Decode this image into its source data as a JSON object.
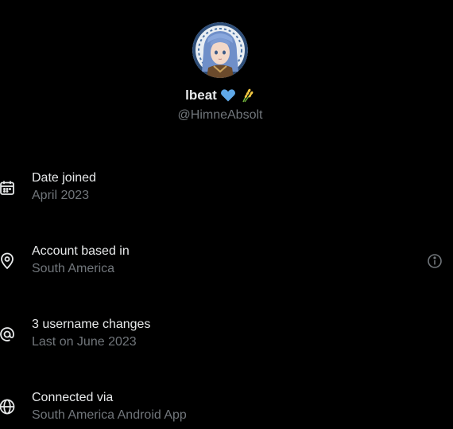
{
  "profile": {
    "display_name": "lbeat",
    "handle": "@HimneAbsolt",
    "badges": [
      "blue-heart-emoji",
      "rice-sheaf-emoji"
    ]
  },
  "about": {
    "items": [
      {
        "icon": "calendar-icon",
        "title": "Date joined",
        "value": "April 2023"
      },
      {
        "icon": "location-pin-icon",
        "title": "Account based in",
        "value": "South America",
        "trailing_icon": "info-icon"
      },
      {
        "icon": "at-sign-icon",
        "title": "3 username changes",
        "value": "Last on June 2023"
      },
      {
        "icon": "globe-icon",
        "title": "Connected via",
        "value": "South America Android App"
      }
    ]
  },
  "colors": {
    "background": "#000000",
    "primary_text": "#e7e9ea",
    "secondary_text": "#71767b",
    "heart": "#5fa8e8"
  }
}
